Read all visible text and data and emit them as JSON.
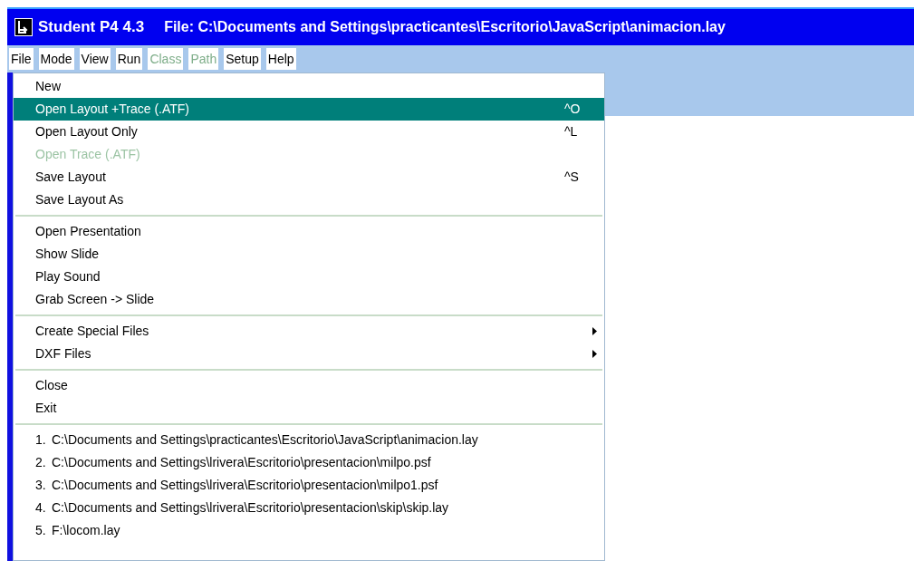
{
  "window": {
    "title": "Student P4 4.3",
    "file_path": "File: C:\\Documents and Settings\\practicantes\\Escritorio\\JavaScript\\animacion.lay"
  },
  "menu_bar": [
    {
      "label": "File",
      "disabled": false
    },
    {
      "label": "Mode",
      "disabled": false
    },
    {
      "label": "View",
      "disabled": false
    },
    {
      "label": "Run",
      "disabled": false
    },
    {
      "label": "Class",
      "disabled": true
    },
    {
      "label": "Path",
      "disabled": true
    },
    {
      "label": "Setup",
      "disabled": false
    },
    {
      "label": "Help",
      "disabled": false
    }
  ],
  "file_menu": [
    {
      "kind": "item",
      "label": "New",
      "selected": false,
      "disabled": false
    },
    {
      "kind": "item",
      "label": "Open Layout +Trace (.ATF)",
      "shortcut": "^O",
      "selected": true,
      "disabled": false
    },
    {
      "kind": "item",
      "label": "Open Layout Only",
      "shortcut": "^L",
      "selected": false,
      "disabled": false
    },
    {
      "kind": "item",
      "label": "Open Trace (.ATF)",
      "selected": false,
      "disabled": true
    },
    {
      "kind": "item",
      "label": "Save Layout",
      "shortcut": "^S",
      "selected": false,
      "disabled": false
    },
    {
      "kind": "item",
      "label": "Save Layout As",
      "selected": false,
      "disabled": false
    },
    {
      "kind": "separator"
    },
    {
      "kind": "item",
      "label": "Open Presentation",
      "selected": false,
      "disabled": false
    },
    {
      "kind": "item",
      "label": "Show Slide",
      "selected": false,
      "disabled": false
    },
    {
      "kind": "item",
      "label": "Play Sound",
      "selected": false,
      "disabled": false
    },
    {
      "kind": "item",
      "label": "Grab Screen -> Slide",
      "selected": false,
      "disabled": false
    },
    {
      "kind": "separator"
    },
    {
      "kind": "submenu",
      "label": "Create Special Files",
      "selected": false,
      "disabled": false
    },
    {
      "kind": "submenu",
      "label": "DXF Files",
      "selected": false,
      "disabled": false
    },
    {
      "kind": "separator"
    },
    {
      "kind": "item",
      "label": "Close",
      "selected": false,
      "disabled": false
    },
    {
      "kind": "item",
      "label": "Exit",
      "selected": false,
      "disabled": false
    },
    {
      "kind": "separator"
    },
    {
      "kind": "recent",
      "number": "1.",
      "label": "C:\\Documents and Settings\\practicantes\\Escritorio\\JavaScript\\animacion.lay",
      "selected": false,
      "disabled": false
    },
    {
      "kind": "recent",
      "number": "2.",
      "label": "C:\\Documents and Settings\\lrivera\\Escritorio\\presentacion\\milpo.psf",
      "selected": false,
      "disabled": false
    },
    {
      "kind": "recent",
      "number": "3.",
      "label": "C:\\Documents and Settings\\lrivera\\Escritorio\\presentacion\\milpo1.psf",
      "selected": false,
      "disabled": false
    },
    {
      "kind": "recent",
      "number": "4.",
      "label": "C:\\Documents and Settings\\lrivera\\Escritorio\\presentacion\\skip\\skip.lay",
      "selected": false,
      "disabled": false
    },
    {
      "kind": "recent",
      "number": "5.",
      "label": "F:\\locom.lay",
      "selected": false,
      "disabled": false
    }
  ]
}
